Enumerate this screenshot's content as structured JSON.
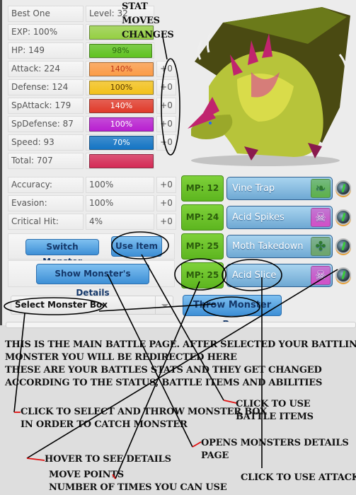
{
  "monster": {
    "name": "Best One",
    "level_label": "Level: 32",
    "image_alt": "green and magenta dragon monster"
  },
  "stats": [
    {
      "label": "EXP: 100%",
      "bar_text": "",
      "bar_fill": 1.0,
      "bar_color": "#95cf43",
      "text_color": "#2c5c0c",
      "delta": ""
    },
    {
      "label": "HP: 149",
      "bar_text": "98%",
      "bar_fill": 0.98,
      "bar_color": "#5fc21f",
      "text_color": "#2c6a10",
      "delta": ""
    },
    {
      "label": "Attack: 224",
      "bar_text": "140%",
      "bar_fill": 1.0,
      "bar_color": "#fb9b46",
      "text_color": "#c0391b",
      "delta": "+0"
    },
    {
      "label": "Defense: 124",
      "bar_text": "100%",
      "bar_fill": 1.0,
      "bar_color": "#f3c11a",
      "text_color": "#5a3b00",
      "delta": "+0"
    },
    {
      "label": "SpAttack: 179",
      "bar_text": "140%",
      "bar_fill": 1.0,
      "bar_color": "#e03a2a",
      "text_color": "#ffffff",
      "delta": "+0"
    },
    {
      "label": "SpDefense: 87",
      "bar_text": "100%",
      "bar_fill": 1.0,
      "bar_color": "#b81fd0",
      "text_color": "#ffffff",
      "delta": "+0"
    },
    {
      "label": "Speed: 93",
      "bar_text": "70%",
      "bar_fill": 1.0,
      "bar_color": "#1374c4",
      "text_color": "#ffffff",
      "delta": "+0"
    },
    {
      "label": "Total: 707",
      "bar_text": "",
      "bar_fill": 1.0,
      "bar_color": "#d42a55",
      "text_color": "#ffffff",
      "delta": ""
    }
  ],
  "extra_stats": [
    {
      "label": "Accuracy:",
      "value": "100%",
      "delta": "+0"
    },
    {
      "label": "Evasion:",
      "value": "100%",
      "delta": "+0"
    },
    {
      "label": "Critical Hit:",
      "value": "4%",
      "delta": "+0"
    }
  ],
  "buttons": {
    "switch_monster": "Switch Monster",
    "use_item": "Use Item",
    "show_details": "Show Monster's Details",
    "throw_box": "Throw Monster Box"
  },
  "monster_box_select": {
    "selected": "Select Monster Box"
  },
  "moves": [
    {
      "mp": "MP: 12",
      "name": "Vine Trap",
      "type": "grass",
      "type_color": "#5fb14a",
      "type_glyph": "❧"
    },
    {
      "mp": "MP: 24",
      "name": "Acid Spikes",
      "type": "poison",
      "type_color": "#d34fc7",
      "type_glyph": "☠"
    },
    {
      "mp": "MP: 25",
      "name": "Moth Takedown",
      "type": "bug",
      "type_color": "#6ea56a",
      "type_glyph": "✤"
    },
    {
      "mp": "MP: 25",
      "name": "Acid Slice",
      "type": "poison",
      "type_color": "#d34fc7",
      "type_glyph": "☠"
    }
  ],
  "annotations": {
    "stat_moves_changes": [
      "STAT",
      "MOVES",
      "CHANGES"
    ],
    "main_intro": [
      "This is the main battle page. After selected your battling",
      "monster you will be redirected here",
      "These are your battles stats and they get changed",
      "according to the status, battle items and abilities"
    ],
    "throw_box": [
      "Click to select and throw monster box",
      "in order to catch monster"
    ],
    "use_items": [
      "Click to use",
      "battle items"
    ],
    "details_page": [
      "Opens monsters details",
      "page"
    ],
    "hover": "Hover to see details",
    "move_points": [
      "Move points",
      "number of times you can use"
    ],
    "use_attack": "Click to use attack"
  }
}
